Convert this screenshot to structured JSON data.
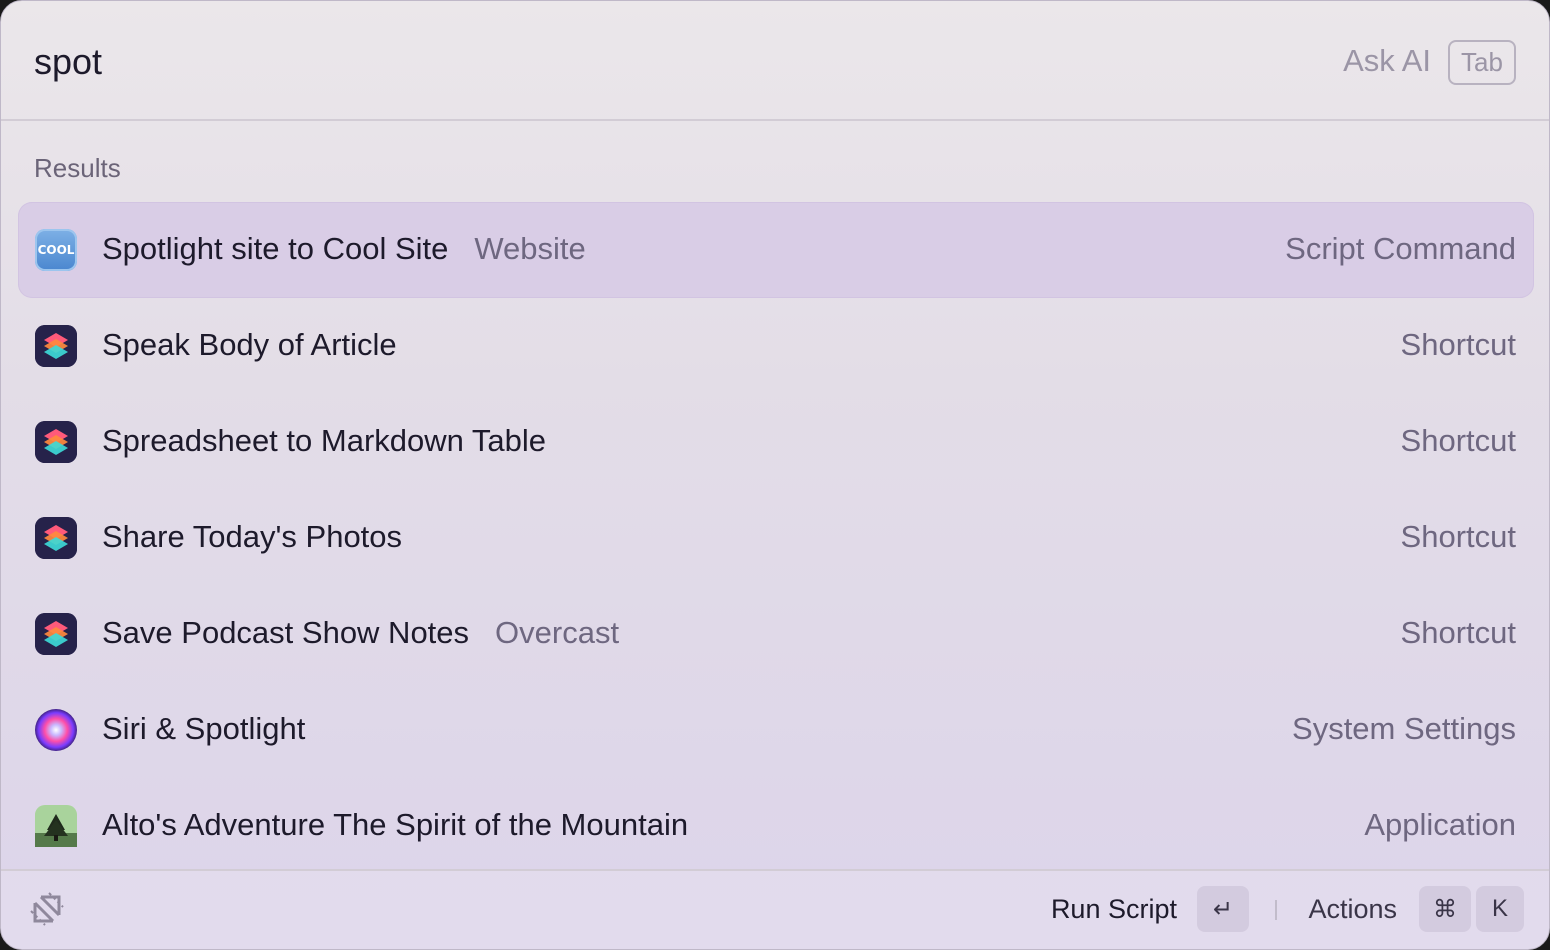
{
  "search": {
    "value": "spot",
    "ask_ai_label": "Ask AI",
    "tab_key": "Tab"
  },
  "results": {
    "section_label": "Results",
    "items": [
      {
        "title": "Spotlight site to Cool Site",
        "subtitle": "Website",
        "type": "Script Command",
        "icon": "cool-icon",
        "icon_text": "COOL",
        "selected": true
      },
      {
        "title": "Speak Body of Article",
        "subtitle": "",
        "type": "Shortcut",
        "icon": "shortcuts-icon"
      },
      {
        "title": "Spreadsheet to Markdown Table",
        "subtitle": "",
        "type": "Shortcut",
        "icon": "shortcuts-icon"
      },
      {
        "title": "Share Today's Photos",
        "subtitle": "",
        "type": "Shortcut",
        "icon": "shortcuts-icon"
      },
      {
        "title": "Save Podcast Show Notes",
        "subtitle": "Overcast",
        "type": "Shortcut",
        "icon": "shortcuts-icon"
      },
      {
        "title": "Siri & Spotlight",
        "subtitle": "",
        "type": "System Settings",
        "icon": "siri-icon"
      },
      {
        "title": "Alto's Adventure The Spirit of the Mountain",
        "subtitle": "",
        "type": "Application",
        "icon": "alto-icon"
      }
    ]
  },
  "footer": {
    "primary_action": "Run Script",
    "enter_key": "↵",
    "actions_label": "Actions",
    "cmd_key": "⌘",
    "k_key": "K",
    "logo_icon": "raycast-logo-icon"
  },
  "colors": {
    "selected_row": "#d9cde6",
    "secondary_text": "#6e6780",
    "primary_text": "#1d1a2b"
  }
}
